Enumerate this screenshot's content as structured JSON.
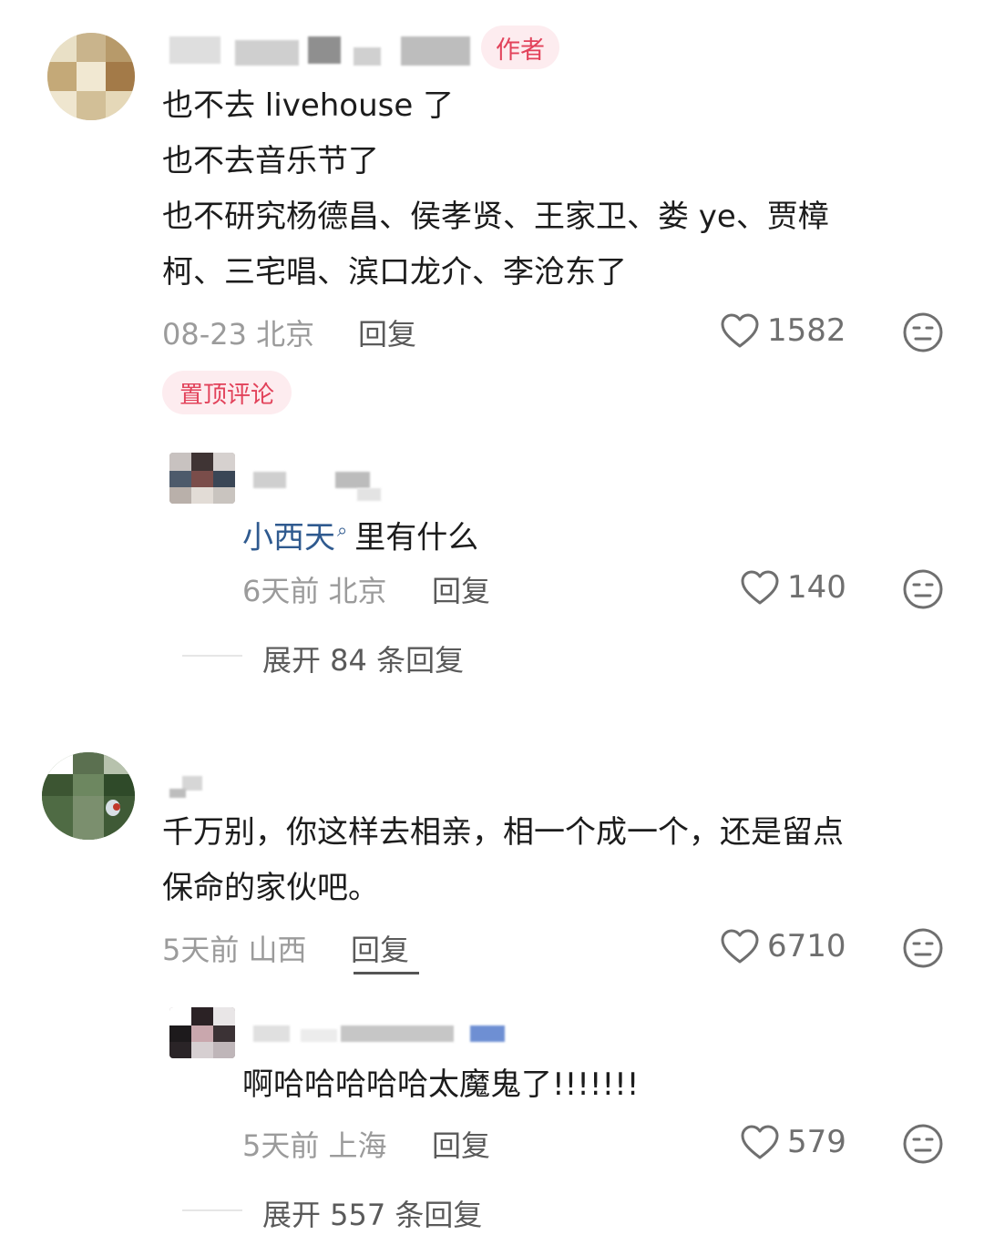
{
  "comments": [
    {
      "author_tag": "作者",
      "lines": [
        "也不去 livehouse 了",
        "也不去音乐节了",
        "也不研究杨德昌、侯孝贤、王家卫、娄 ye、贾樟",
        "柯、三宅唱、滨口龙介、李沧东了"
      ],
      "meta": "08-23 北京",
      "reply_label": "回复",
      "likes": "1582",
      "pinned_label": "置顶评论",
      "reply": {
        "link_text": "小西天",
        "rest_text": "里有什么",
        "meta": "6天前 北京",
        "reply_label": "回复",
        "likes": "140"
      },
      "expand_label": "展开 84 条回复"
    },
    {
      "lines": [
        "千万别，你这样去相亲，相一个成一个，还是留点",
        "保命的家伙吧。"
      ],
      "meta": "5天前 山西",
      "reply_label": "回复",
      "likes": "6710",
      "reply": {
        "text": "啊哈哈哈哈哈太魔鬼了!!!!!!!",
        "meta": "5天前 上海",
        "reply_label": "回复",
        "likes": "579"
      },
      "expand_label": "展开 557 条回复"
    }
  ],
  "icons": {
    "like": "heart-icon",
    "dislike": "meh-face-icon",
    "search": "search-icon"
  },
  "colors": {
    "accent": "#e2425a",
    "link": "#2f5a8f",
    "muted": "#9b9b9b"
  }
}
